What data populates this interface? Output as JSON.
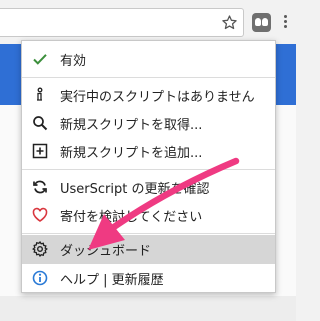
{
  "toolbar": {
    "bookmark_icon": "star-icon",
    "extension_icon": "tampermonkey-icon",
    "menu_icon": "more-vert-icon"
  },
  "menu": {
    "enabled": {
      "icon": "checkmark-icon",
      "label": "有効"
    },
    "running": {
      "icon": "info-icon",
      "label": "実行中のスクリプトはありません"
    },
    "get_script": {
      "icon": "search-icon",
      "label": "新規スクリプトを取得..."
    },
    "add_script": {
      "icon": "add-box-icon",
      "label": "新規スクリプトを追加..."
    },
    "check_updates": {
      "icon": "refresh-icon",
      "label": "UserScript の更新を確認"
    },
    "donate": {
      "icon": "heart-icon",
      "label": "寄付を検討してください"
    },
    "dashboard": {
      "icon": "gear-icon",
      "label": "ダッシュボード"
    },
    "help": {
      "icon": "info-circle-icon",
      "label": "ヘルプ | 更新履歴"
    }
  },
  "colors": {
    "check": "#3c8f3c",
    "heart": "#d9363e",
    "info": "#2a7ad6",
    "arrow": "#ef3a82",
    "header": "#2f6fd5",
    "highlight": "#d6d6d6"
  }
}
